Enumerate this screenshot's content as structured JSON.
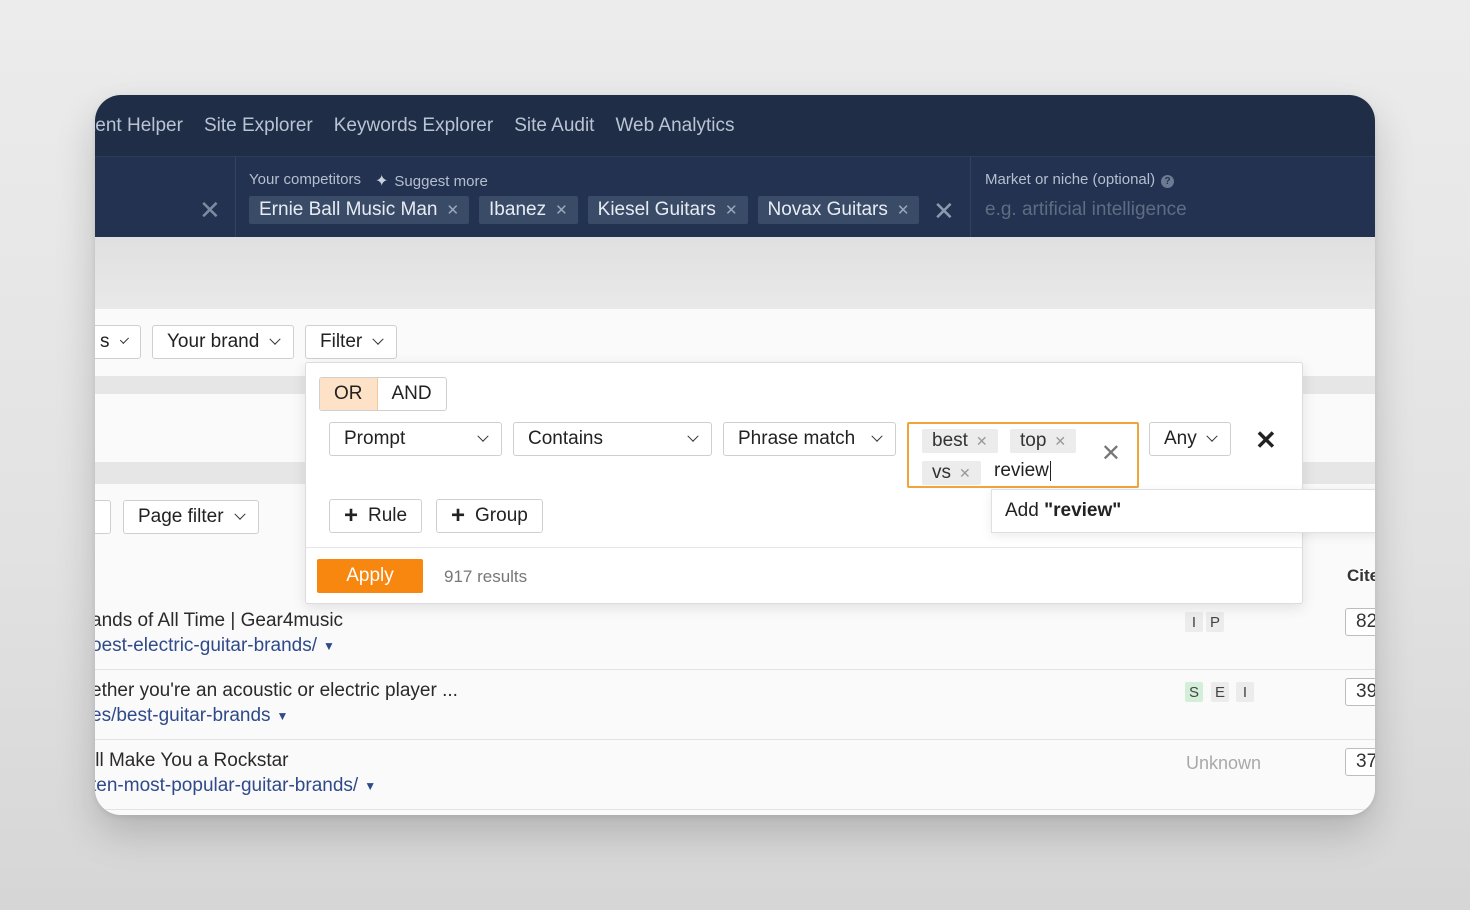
{
  "nav": {
    "items": [
      "tent Helper",
      "Site Explorer",
      "Keywords Explorer",
      "Site Audit",
      "Web Analytics"
    ]
  },
  "competitors": {
    "label": "Your competitors",
    "suggest": "Suggest more",
    "chips": [
      "Ernie Ball Music Man",
      "Ibanez",
      "Kiesel Guitars",
      "Novax Guitars"
    ]
  },
  "market": {
    "label": "Market or niche (optional)",
    "placeholder": "e.g. artificial intelligence"
  },
  "toolbar": {
    "partial_label": "s",
    "brand_label": "Your brand",
    "filter_label": "Filter",
    "page_filter_label": "Page filter"
  },
  "filter": {
    "or_label": "OR",
    "and_label": "AND",
    "field_select": "Prompt",
    "operator_select": "Contains",
    "match_select": "Phrase match",
    "tags": [
      "best",
      "top",
      "vs"
    ],
    "typed_value": "review",
    "any_select": "Any",
    "rule_label": "Rule",
    "group_label": "Group",
    "apply_label": "Apply",
    "results_text": "917 results",
    "suggestion_prefix": "Add ",
    "suggestion_value": "\"review\""
  },
  "table": {
    "column_header": "Cite",
    "rows": [
      {
        "title": "ands of All Time | Gear4music",
        "url": "oest-electric-guitar-brands/",
        "badges": [
          "I",
          "P"
        ],
        "value": "82"
      },
      {
        "title": "ether you're an acoustic or electric player ...",
        "url": "es/best-guitar-brands",
        "badges": [
          "S",
          "E",
          "I"
        ],
        "value": "39"
      },
      {
        "title": "ill Make You a Rockstar",
        "url": "ten-most-popular-guitar-brands/",
        "intent": "Unknown",
        "value": "37"
      }
    ]
  },
  "colors": {
    "nav_bg": "#1f2d46",
    "accent_orange": "#f7870f",
    "or_active_bg": "#fde2c7",
    "link_blue": "#2f4a8a"
  }
}
